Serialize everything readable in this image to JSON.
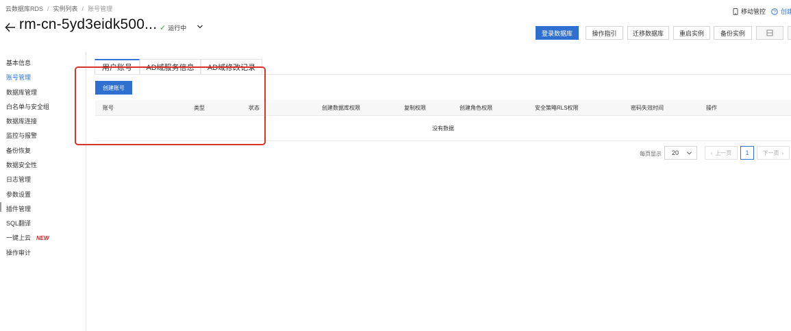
{
  "breadcrumb": [
    "云数据库RDS",
    "实例列表",
    "账号管理"
  ],
  "topbar": {
    "mobile_label": "移动管控",
    "create_label": "创建"
  },
  "header": {
    "title": "rm-cn-5yd3eidk500...",
    "status": "运行中"
  },
  "actions": {
    "login": "登录数据库",
    "guide": "操作指引",
    "migrate": "迁移数据库",
    "restart": "重启实例",
    "backup": "备份实例"
  },
  "sidebar": {
    "items": [
      {
        "label": "基本信息"
      },
      {
        "label": "账号管理"
      },
      {
        "label": "数据库管理"
      },
      {
        "label": "白名单与安全组"
      },
      {
        "label": "数据库连接"
      },
      {
        "label": "监控与报警"
      },
      {
        "label": "备份恢复"
      },
      {
        "label": "数据安全性"
      },
      {
        "label": "日志管理"
      },
      {
        "label": "参数设置"
      },
      {
        "label": "插件管理"
      },
      {
        "label": "SQL翻译"
      },
      {
        "label": "一键上云",
        "badge": "NEW"
      },
      {
        "label": "操作审计"
      }
    ]
  },
  "tabs": [
    "用户账号",
    "AD域服务信息",
    "AD域修改记录"
  ],
  "create_account": "创建账号",
  "table": {
    "columns": [
      "账号",
      "类型",
      "状态",
      "创建数据库权限",
      "复制权限",
      "创建角色权限",
      "安全策略RLS权限",
      "密码失效时间",
      "操作"
    ],
    "empty_text": "没有数据"
  },
  "pagination": {
    "page_size_label": "每页显示",
    "page_size": "20",
    "prev": "上一页",
    "current": "1",
    "next": "下一页"
  },
  "colors": {
    "primary": "#2f6fd0",
    "link": "#2e74d4",
    "highlight": "#d9322b",
    "running": "#3aa655",
    "new_badge": "#e02020"
  }
}
